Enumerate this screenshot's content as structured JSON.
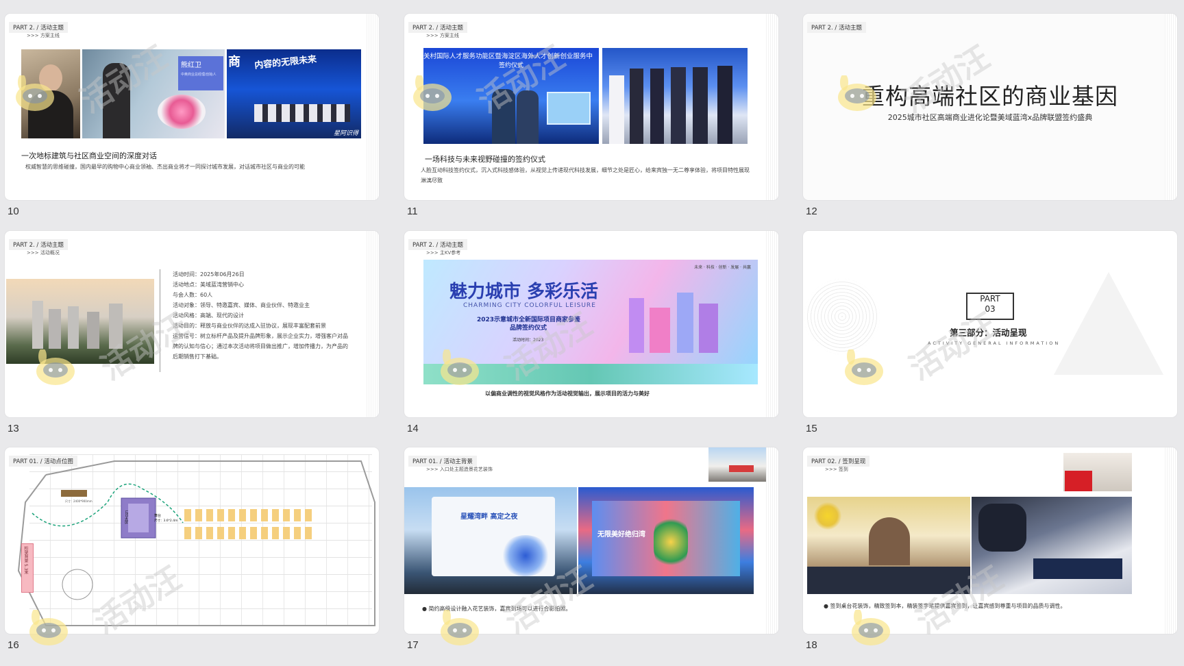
{
  "slides": [
    {
      "number": "10",
      "part": "PART 2. / 活动主题",
      "section": ">>> 方案主线",
      "caption": "一次地标建筑与社区商业空间的深度对话",
      "body": "权威智慧的思维碰撞，国内最早的购物中心商业领袖、杰出商业将才一同探讨城市发展，对话城市社区与商业的可能",
      "photo_texts": [
        "熊红卫",
        "中奥商业总经理/创始人",
        "商",
        "内容的无限未来",
        "星阿识得"
      ]
    },
    {
      "number": "11",
      "part": "PART 2. / 活动主题",
      "section": ">>> 方案主线",
      "caption": "一场科技与未来视野碰撞的签约仪式",
      "body": "人脸互动科技签约仪式，沉入式科技感体验，从视觉上传递现代科技发展，细节之处是匠心，给来宾独一无二尊享体验，将项目特性展现淋漓尽致",
      "photo_texts": [
        "关村国际人才服务功能区暨海淀区海外人才创新创业服务中",
        "签约仪式"
      ]
    },
    {
      "number": "12",
      "part": "PART 2. / 活动主题",
      "title": "重构高端社区的商业基因",
      "subtitle": "2025城市社区高端商业进化论暨美域蓝湾x品牌联盟签约盛典"
    },
    {
      "number": "13",
      "part": "PART 2. / 活动主题",
      "section": ">>> 活动概况",
      "details": [
        "活动时间：2025年06月26日",
        "活动地点：美域蓝湾营销中心",
        "与会人数：60人",
        "活动对象：领导、特邀嘉宾、媒体、商业伙伴、特邀业主",
        "活动风格：高端、现代的设计",
        "活动目的：释放与商业伙伴的达成入驻协议，展现丰富配套前景",
        "运营信号：树立标杆产品及提升品牌形象，展示企业实力，增强客户对品",
        "牌的认知与信心；通过本次活动将项目做出推广，增加传播力，为产品的",
        "后期销售打下基础。"
      ]
    },
    {
      "number": "14",
      "part": "PART 2. / 活动主题",
      "section": ">>> 主KV参考",
      "kv_title": "魅力城市 多彩乐活",
      "kv_en": "CHARMING CITY COLORFUL LEISURE",
      "kv_sub1": "2023示意城市全新国际项目商家参鉴",
      "kv_sub2": "品牌签约仪式",
      "kv_tags": "未来 · 科技 · 创新 · 发展 · 共赢",
      "kv_small": "活动时间：2023",
      "caption": "以偏商业调性的视觉风格作为活动视觉输出，展示项目的活力与美好"
    },
    {
      "number": "15",
      "part_badge_line1": "PART",
      "part_badge_line2": "03",
      "title": "第三部分：活动呈现",
      "subtitle": "ACTIVITY GENERAL INFORMATION"
    },
    {
      "number": "16",
      "part": "PART 01. / 活动点位图",
      "labels": [
        "LED大屏",
        "舞台",
        "尺寸：3.6*2.4m",
        "签到处",
        "餐饮区",
        "观礼区",
        "休息区",
        "沙盘",
        "桁架背景 5.3米",
        "尺寸：2400*900mm"
      ]
    },
    {
      "number": "17",
      "part": "PART 01. / 活动主背景",
      "section": ">>> 入口处主题造景花艺装饰",
      "bullet": "简约高级设计融入花艺装饰，嘉宾到场可以进行合影拍照。",
      "photo_texts": [
        "星耀湾畔 高定之夜",
        "无限美好绝归湾"
      ]
    },
    {
      "number": "18",
      "part": "PART 02. / 签到呈现",
      "section": ">>> 签到",
      "bullet": "签到桌台花装饰，精致签到本，精装签字笔提供嘉宾签到，让嘉宾感到尊重与项目的品质与调性。"
    }
  ],
  "watermark_text": "活动汪"
}
